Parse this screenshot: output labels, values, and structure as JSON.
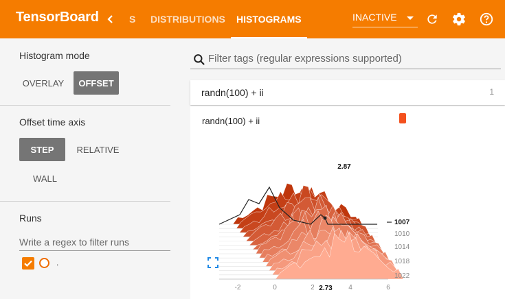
{
  "header": {
    "brand": "TensorBoard",
    "tabs": [
      {
        "label": "S"
      },
      {
        "label": "DISTRIBUTIONS"
      },
      {
        "label": "HISTOGRAMS"
      }
    ],
    "run_select": "INACTIVE",
    "accent_color": "#f57c00"
  },
  "sidebar": {
    "histogram_mode": {
      "title": "Histogram mode",
      "options": [
        "OVERLAY",
        "OFFSET"
      ],
      "selected": "OFFSET"
    },
    "time_axis": {
      "title": "Offset time axis",
      "options": [
        "STEP",
        "RELATIVE",
        "WALL"
      ],
      "selected": "STEP"
    },
    "runs": {
      "title": "Runs",
      "placeholder": "Write a regex to filter runs",
      "items": [
        {
          "name": ".",
          "checked": true
        }
      ]
    }
  },
  "main": {
    "filter_placeholder": "Filter tags (regular expressions supported)",
    "tag_group": {
      "name": "randn(100) + ii",
      "count": "1"
    },
    "card": {
      "title": "randn(100) + ii"
    }
  },
  "chart_data": {
    "type": "area",
    "title": "randn(100) + ii",
    "x_ticks": [
      "-2",
      "0",
      "2",
      "4",
      "6"
    ],
    "y_ticks": [
      "1007",
      "1010",
      "1014",
      "1018",
      "1022"
    ],
    "hover": {
      "step": "1007",
      "x_label": "2.73",
      "top_value": "2.87"
    },
    "series_colors": [
      "#bf360c",
      "#e64a19",
      "#ff7043",
      "#ffab91"
    ]
  }
}
